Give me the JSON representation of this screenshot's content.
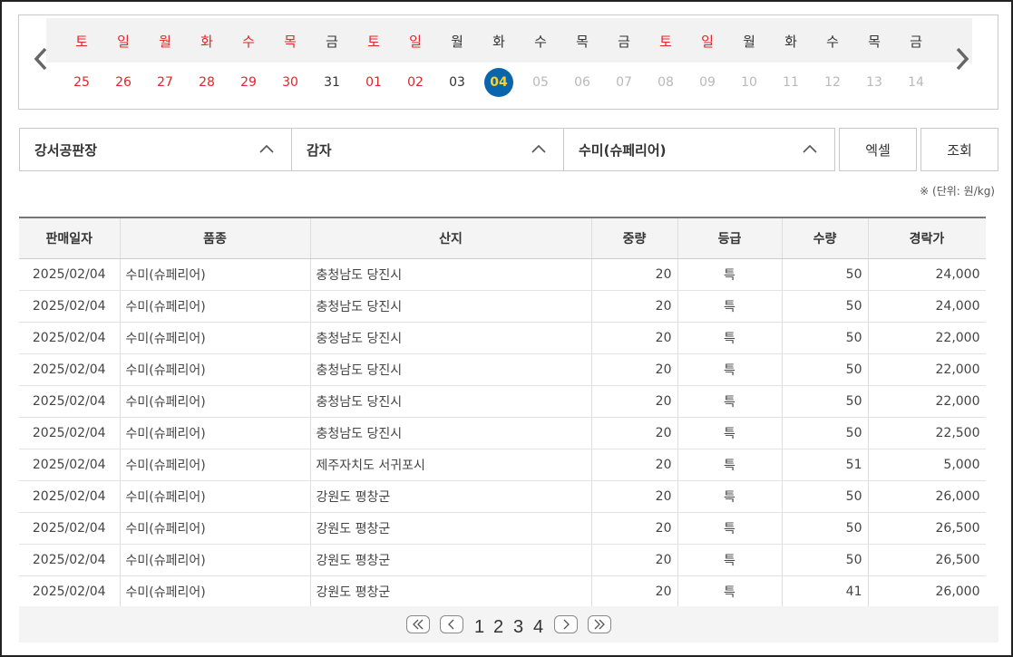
{
  "calendar": {
    "days": [
      {
        "dow": "토",
        "num": "25",
        "dow_color": "red",
        "num_color": "red"
      },
      {
        "dow": "일",
        "num": "26",
        "dow_color": "red",
        "num_color": "red"
      },
      {
        "dow": "월",
        "num": "27",
        "dow_color": "red",
        "num_color": "red"
      },
      {
        "dow": "화",
        "num": "28",
        "dow_color": "red",
        "num_color": "red"
      },
      {
        "dow": "수",
        "num": "29",
        "dow_color": "red",
        "num_color": "red"
      },
      {
        "dow": "목",
        "num": "30",
        "dow_color": "red",
        "num_color": "red"
      },
      {
        "dow": "금",
        "num": "31",
        "dow_color": "dark",
        "num_color": "dark"
      },
      {
        "dow": "토",
        "num": "01",
        "dow_color": "red",
        "num_color": "red"
      },
      {
        "dow": "일",
        "num": "02",
        "dow_color": "red",
        "num_color": "red"
      },
      {
        "dow": "월",
        "num": "03",
        "dow_color": "dark",
        "num_color": "dark"
      },
      {
        "dow": "화",
        "num": "04",
        "dow_color": "dark",
        "num_color": "selected"
      },
      {
        "dow": "수",
        "num": "05",
        "dow_color": "dark",
        "num_color": "grey"
      },
      {
        "dow": "목",
        "num": "06",
        "dow_color": "dark",
        "num_color": "grey"
      },
      {
        "dow": "금",
        "num": "07",
        "dow_color": "dark",
        "num_color": "grey"
      },
      {
        "dow": "토",
        "num": "08",
        "dow_color": "red",
        "num_color": "grey"
      },
      {
        "dow": "일",
        "num": "09",
        "dow_color": "red",
        "num_color": "grey"
      },
      {
        "dow": "월",
        "num": "10",
        "dow_color": "dark",
        "num_color": "grey"
      },
      {
        "dow": "화",
        "num": "11",
        "dow_color": "dark",
        "num_color": "grey"
      },
      {
        "dow": "수",
        "num": "12",
        "dow_color": "dark",
        "num_color": "grey"
      },
      {
        "dow": "목",
        "num": "13",
        "dow_color": "dark",
        "num_color": "grey"
      },
      {
        "dow": "금",
        "num": "14",
        "dow_color": "dark",
        "num_color": "grey"
      }
    ],
    "selected_num": "04"
  },
  "filters": {
    "market": "강서공판장",
    "item": "감자",
    "variety": "수미(슈페리어)"
  },
  "buttons": {
    "excel": "엑셀",
    "query": "조회"
  },
  "unit_note": "※ (단위: 원/kg)",
  "table": {
    "headers": [
      "판매일자",
      "품종",
      "산지",
      "중량",
      "등급",
      "수량",
      "경락가"
    ],
    "rows": [
      [
        "2025/02/04",
        "수미(슈페리어)",
        "충청남도 당진시",
        "20",
        "특",
        "50",
        "24,000"
      ],
      [
        "2025/02/04",
        "수미(슈페리어)",
        "충청남도 당진시",
        "20",
        "특",
        "50",
        "24,000"
      ],
      [
        "2025/02/04",
        "수미(슈페리어)",
        "충청남도 당진시",
        "20",
        "특",
        "50",
        "22,000"
      ],
      [
        "2025/02/04",
        "수미(슈페리어)",
        "충청남도 당진시",
        "20",
        "특",
        "50",
        "22,000"
      ],
      [
        "2025/02/04",
        "수미(슈페리어)",
        "충청남도 당진시",
        "20",
        "특",
        "50",
        "22,000"
      ],
      [
        "2025/02/04",
        "수미(슈페리어)",
        "충청남도 당진시",
        "20",
        "특",
        "50",
        "22,500"
      ],
      [
        "2025/02/04",
        "수미(슈페리어)",
        "제주자치도 서귀포시",
        "20",
        "특",
        "51",
        "5,000"
      ],
      [
        "2025/02/04",
        "수미(슈페리어)",
        "강원도 평창군",
        "20",
        "특",
        "50",
        "26,000"
      ],
      [
        "2025/02/04",
        "수미(슈페리어)",
        "강원도 평창군",
        "20",
        "특",
        "50",
        "26,500"
      ],
      [
        "2025/02/04",
        "수미(슈페리어)",
        "강원도 평창군",
        "20",
        "특",
        "50",
        "26,500"
      ],
      [
        "2025/02/04",
        "수미(슈페리어)",
        "강원도 평창군",
        "20",
        "특",
        "41",
        "26,000"
      ]
    ]
  },
  "pagination": {
    "pages": [
      "1",
      "2",
      "3",
      "4"
    ],
    "current": "1"
  },
  "colors": {
    "red": "#e0262a",
    "selected_bg": "#0b65ad",
    "selected_text": "#ffd21f"
  }
}
